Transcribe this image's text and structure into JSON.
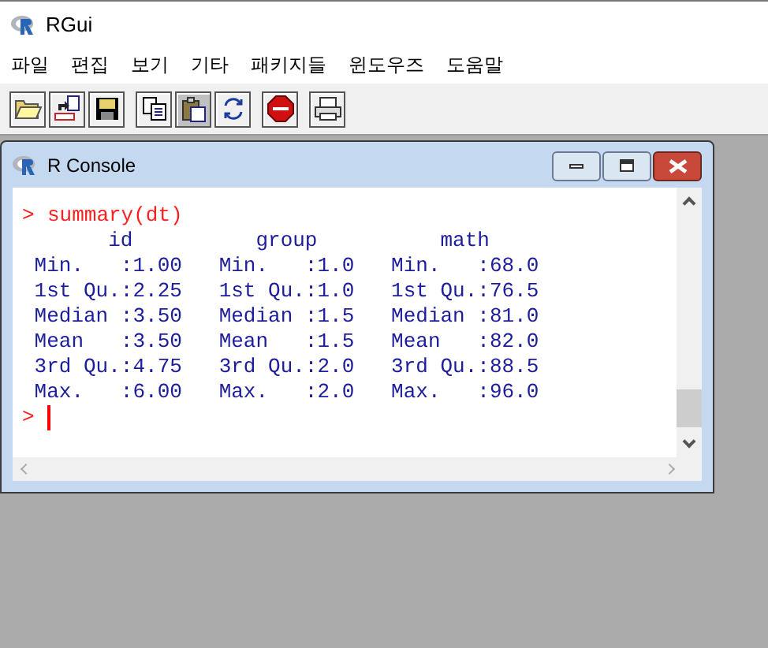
{
  "window": {
    "title": "RGui"
  },
  "menu": [
    "파일",
    "편집",
    "보기",
    "기타",
    "패키지들",
    "윈도우즈",
    "도움말"
  ],
  "console": {
    "title": "R Console",
    "lines": [
      {
        "kind": "input",
        "prompt": ">",
        "text": "summary(dt)"
      },
      {
        "kind": "output",
        "text": "       id          group          math     "
      },
      {
        "kind": "output",
        "text": " Min.   :1.00   Min.   :1.0   Min.   :68.0  "
      },
      {
        "kind": "output",
        "text": " 1st Qu.:2.25   1st Qu.:1.0   1st Qu.:76.5  "
      },
      {
        "kind": "output",
        "text": " Median :3.50   Median :1.5   Median :81.0  "
      },
      {
        "kind": "output",
        "text": " Mean   :3.50   Mean   :1.5   Mean   :82.0  "
      },
      {
        "kind": "output",
        "text": " 3rd Qu.:4.75   3rd Qu.:2.0   3rd Qu.:88.5  "
      },
      {
        "kind": "output",
        "text": " Max.   :6.00   Max.   :2.0   Max.   :96.0  "
      },
      {
        "kind": "prompt",
        "prompt": ">"
      }
    ]
  }
}
